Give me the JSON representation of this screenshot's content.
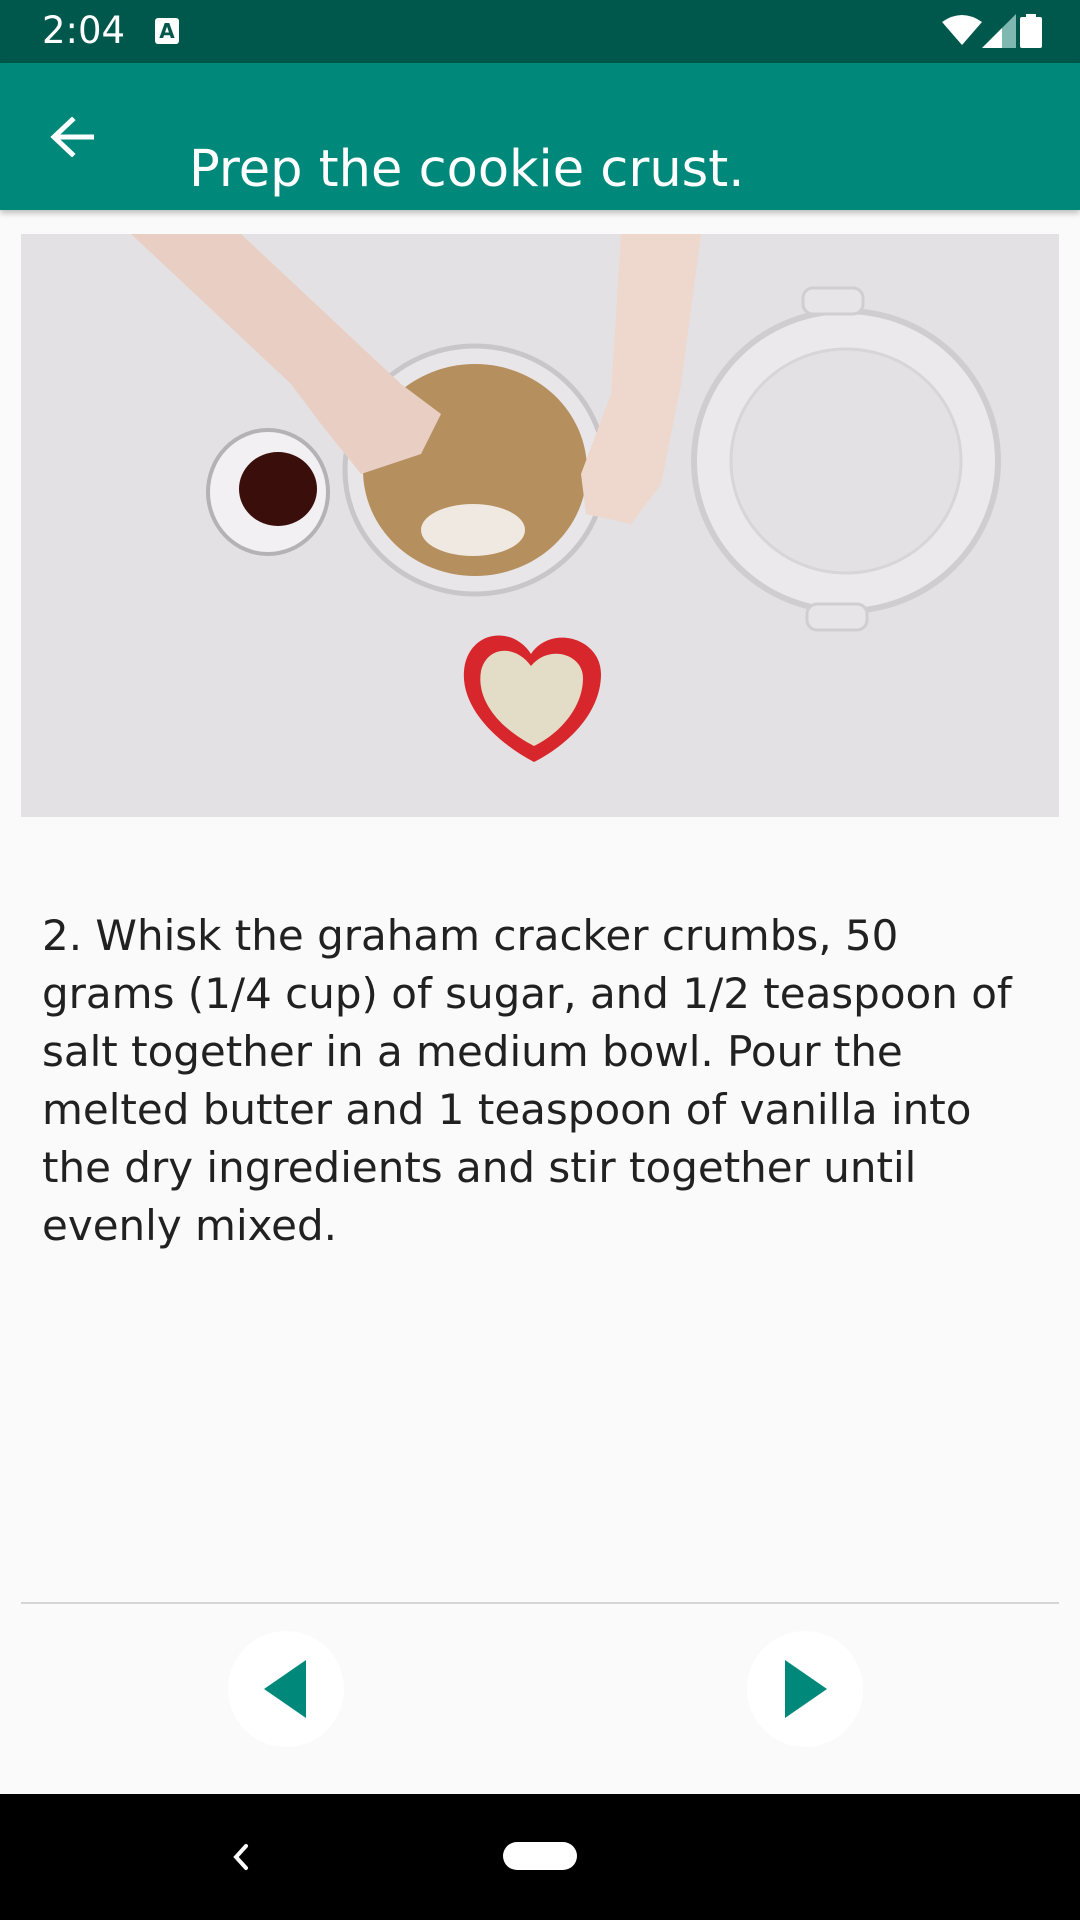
{
  "status_bar": {
    "time": "2:04",
    "notification_icon": "text-a-icon",
    "notification_glyph": "A",
    "icons": [
      "wifi-icon",
      "cellular-signal-icon",
      "battery-icon"
    ]
  },
  "app_bar": {
    "back_icon": "arrow-left-icon",
    "title": "Prep the cookie crust.",
    "color": "#00897b",
    "status_color": "#00574b"
  },
  "step": {
    "text": "2. Whisk the graham cracker crumbs, 50 grams (1/4 cup) of sugar, and 1/2 teaspoon of salt together in a medium bowl. Pour the melted butter and 1 teaspoon of vanilla into the dry ingredients and stir together until evenly mixed."
  },
  "navigation": {
    "previous_icon": "triangle-left-icon",
    "next_icon": "triangle-right-icon",
    "accent_color": "#00897b"
  },
  "system_nav": {
    "back_icon": "chevron-left-icon",
    "home_icon": "home-pill-icon"
  }
}
